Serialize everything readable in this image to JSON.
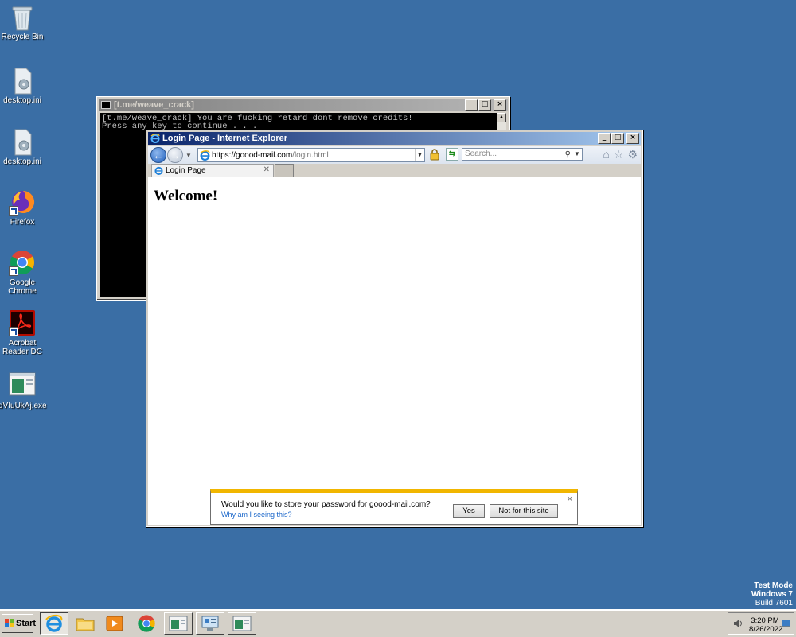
{
  "desktop": {
    "icons": [
      {
        "label": "Recycle Bin",
        "icon": "recycle-bin-icon"
      },
      {
        "label": "desktop.ini",
        "icon": "file-ini-icon"
      },
      {
        "label": "desktop.ini",
        "icon": "file-ini-icon"
      },
      {
        "label": "Firefox",
        "icon": "firefox-icon"
      },
      {
        "label": "Google Chrome",
        "icon": "chrome-icon"
      },
      {
        "label": "Acrobat Reader DC",
        "icon": "acrobat-icon"
      },
      {
        "label": "dVIuUkAj.exe",
        "icon": "exe-icon"
      }
    ]
  },
  "console": {
    "title": "[t.me/weave_crack]",
    "lines": [
      "[t.me/weave_crack] You are fucking retard dont remove credits!",
      "Press any key to continue . . ."
    ]
  },
  "ie": {
    "title": "Login Page - Internet Explorer",
    "address_host": "https://goood-mail.com",
    "address_path": "/login.html",
    "search_placeholder": "Search...",
    "tab_label": "Login Page",
    "page_heading": "Welcome!",
    "notification": {
      "message": "Would you like to store your password for goood-mail.com?",
      "link": "Why am I seeing this?",
      "yes": "Yes",
      "no": "Not for this site"
    }
  },
  "watermark": {
    "line1": "Test Mode",
    "line2": "Windows 7",
    "line3": "Build 7601"
  },
  "taskbar": {
    "start_label": "Start",
    "time": "3:20 PM",
    "date": "8/26/2022",
    "items": [
      "ie-icon",
      "explorer-icon",
      "media-player-icon",
      "chrome-icon",
      "app-window-icon",
      "network-app-icon",
      "app-window-icon"
    ]
  },
  "colors": {
    "desktop": "#3a6ea5",
    "titlebar_active": "#0a246a",
    "notification_accent": "#f1b600"
  }
}
